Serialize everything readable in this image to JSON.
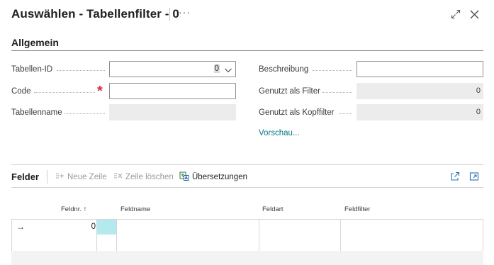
{
  "header": {
    "title": "Auswählen - Tabellenfilter - 0",
    "more_label": "···"
  },
  "section": {
    "title": "Allgemein"
  },
  "fields": {
    "tabellen_id": {
      "label": "Tabellen-ID",
      "value": "0"
    },
    "code": {
      "label": "Code",
      "value": "",
      "required_mark": "*"
    },
    "tabellenname": {
      "label": "Tabellenname",
      "value": ""
    },
    "beschreibung": {
      "label": "Beschreibung",
      "value": ""
    },
    "genutzt_als_filter": {
      "label": "Genutzt als Filter",
      "value": "0"
    },
    "genutzt_als_kopffilter": {
      "label": "Genutzt als Kopffilter",
      "value": "0"
    },
    "vorschau_link": "Vorschau..."
  },
  "part": {
    "title": "Felder",
    "actions": {
      "neue_zeile": "Neue Zeile",
      "zeile_loeschen": "Zeile löschen",
      "uebersetzungen": "Übersetzungen"
    },
    "columns": {
      "feldnr": "Feldnr. ↑",
      "feldname": "Feldname",
      "feldart": "Feldart",
      "feldfilter": "Feldfilter"
    },
    "rows": [
      {
        "indicator": "→",
        "feldnr": "0",
        "feldname": "",
        "feldart": "",
        "feldfilter": ""
      },
      {
        "indicator": "",
        "feldnr": "",
        "feldname": "",
        "feldart": "",
        "feldfilter": ""
      }
    ]
  },
  "colors": {
    "accent_link": "#00777f",
    "required": "#d13438",
    "selected_cell": "#b3e9ef"
  }
}
